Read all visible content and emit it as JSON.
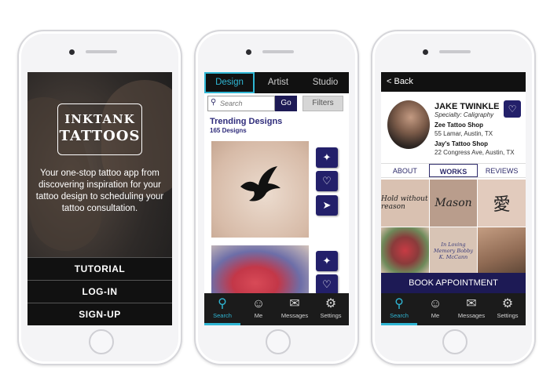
{
  "colors": {
    "navy": "#1d1a55",
    "accent_cyan": "#2fb6d4",
    "black": "#111111"
  },
  "phone1": {
    "logo_line1": "INKTANK",
    "logo_line2": "TATTOOS",
    "tagline": "Your one-stop tattoo app from discovering inspiration for your tattoo design to scheduling your tattoo consultation.",
    "menu": [
      "TUTORIAL",
      "LOG-IN",
      "SIGN-UP"
    ]
  },
  "phone2": {
    "tabs": [
      "Design",
      "Artist",
      "Studio"
    ],
    "active_tab": "Design",
    "search_placeholder": "Search",
    "go_label": "Go",
    "filters_label": "Filters",
    "trending_title": "Trending Designs",
    "trending_count": "165 Designs",
    "card_actions": [
      "magic-wand-icon",
      "heart-icon",
      "send-icon"
    ],
    "tabbar": [
      {
        "label": "Search",
        "icon": "search-icon"
      },
      {
        "label": "Me",
        "icon": "user-icon"
      },
      {
        "label": "Messages",
        "icon": "chat-icon"
      },
      {
        "label": "Settings",
        "icon": "gear-icon"
      }
    ],
    "active_tabbar": "Search"
  },
  "phone3": {
    "back_label": "< Back",
    "artist_name": "JAKE TWINKLE",
    "specialty": "Specialty: Caligraphy",
    "shops": [
      {
        "name": "Zee Tattoo Shop",
        "address": "55 Lamar, Austin, TX"
      },
      {
        "name": "Jay's Tattoo Shop",
        "address": "22 Congress Ave, Austin, TX"
      }
    ],
    "tabs": [
      "ABOUT",
      "WORKS",
      "REVIEWS"
    ],
    "active_tab": "WORKS",
    "gallery": [
      "Hold without reason",
      "Mason",
      "愛",
      "",
      "In Loving Memory Bobby K. McCann",
      ""
    ],
    "book_label": "BOOK APPOINTMENT",
    "tabbar": [
      {
        "label": "Search",
        "icon": "search-icon"
      },
      {
        "label": "Me",
        "icon": "user-icon"
      },
      {
        "label": "Messages",
        "icon": "chat-icon"
      },
      {
        "label": "Settings",
        "icon": "gear-icon"
      }
    ],
    "active_tabbar": "Search"
  }
}
